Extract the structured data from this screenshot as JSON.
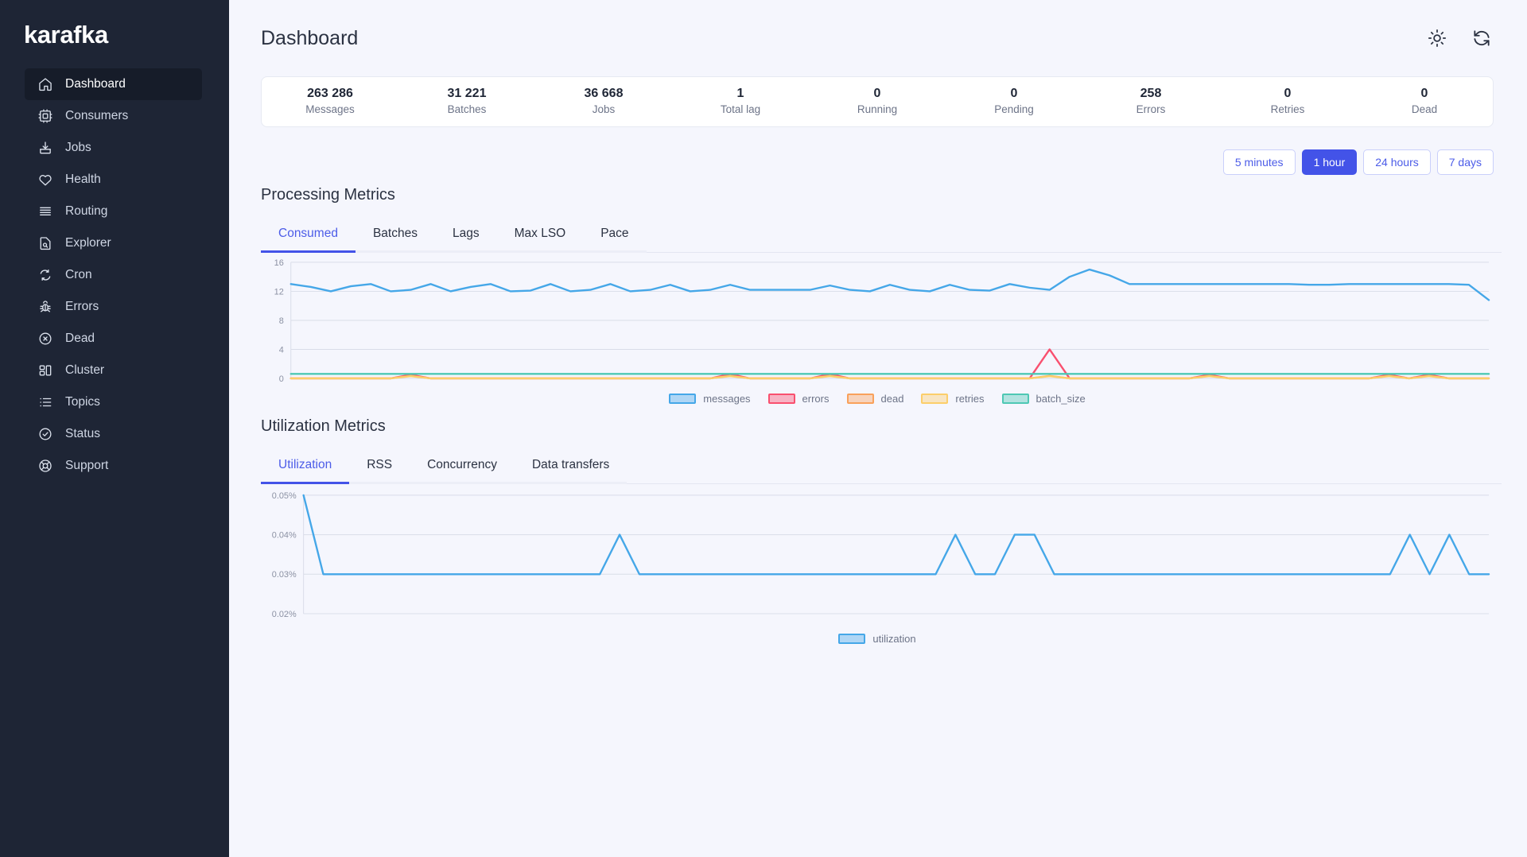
{
  "brand": "karafka",
  "sidebar": {
    "items": [
      {
        "label": "Dashboard",
        "icon": "home-icon",
        "active": true
      },
      {
        "label": "Consumers",
        "icon": "chip-icon",
        "active": false
      },
      {
        "label": "Jobs",
        "icon": "download-box-icon",
        "active": false
      },
      {
        "label": "Health",
        "icon": "heart-icon",
        "active": false
      },
      {
        "label": "Routing",
        "icon": "layers-icon",
        "active": false
      },
      {
        "label": "Explorer",
        "icon": "file-search-icon",
        "active": false
      },
      {
        "label": "Cron",
        "icon": "refresh-cycle-icon",
        "active": false
      },
      {
        "label": "Errors",
        "icon": "bug-icon",
        "active": false
      },
      {
        "label": "Dead",
        "icon": "circle-x-icon",
        "active": false
      },
      {
        "label": "Cluster",
        "icon": "grid-blocks-icon",
        "active": false
      },
      {
        "label": "Topics",
        "icon": "list-icon",
        "active": false
      },
      {
        "label": "Status",
        "icon": "circle-check-icon",
        "active": false
      },
      {
        "label": "Support",
        "icon": "lifebuoy-icon",
        "active": false
      }
    ]
  },
  "header": {
    "title": "Dashboard",
    "theme_toggle_icon": "sun-icon",
    "refresh_icon": "refresh-icon"
  },
  "stats": [
    {
      "value": "263 286",
      "label": "Messages"
    },
    {
      "value": "31 221",
      "label": "Batches"
    },
    {
      "value": "36 668",
      "label": "Jobs"
    },
    {
      "value": "1",
      "label": "Total lag"
    },
    {
      "value": "0",
      "label": "Running"
    },
    {
      "value": "0",
      "label": "Pending"
    },
    {
      "value": "258",
      "label": "Errors"
    },
    {
      "value": "0",
      "label": "Retries"
    },
    {
      "value": "0",
      "label": "Dead"
    }
  ],
  "time_ranges": [
    {
      "label": "5 minutes",
      "active": false
    },
    {
      "label": "1 hour",
      "active": true
    },
    {
      "label": "24 hours",
      "active": false
    },
    {
      "label": "7 days",
      "active": false
    }
  ],
  "processing": {
    "title": "Processing Metrics",
    "tabs": [
      {
        "label": "Consumed",
        "active": true
      },
      {
        "label": "Batches",
        "active": false
      },
      {
        "label": "Lags",
        "active": false
      },
      {
        "label": "Max LSO",
        "active": false
      },
      {
        "label": "Pace",
        "active": false
      }
    ]
  },
  "utilization": {
    "title": "Utilization Metrics",
    "tabs": [
      {
        "label": "Utilization",
        "active": true
      },
      {
        "label": "RSS",
        "active": false
      },
      {
        "label": "Concurrency",
        "active": false
      },
      {
        "label": "Data transfers",
        "active": false
      }
    ]
  },
  "colors": {
    "accent": "#4353e8",
    "messages": "#45a7e8",
    "errors": "#f9506f",
    "dead": "#f9a15b",
    "retries": "#fcce6a",
    "batch_size": "#4ec8b4",
    "sidebar_bg": "#1e2535",
    "page_bg": "#f5f6fd"
  },
  "chart_data": [
    {
      "type": "line",
      "title": "Consumed",
      "xlabel": "",
      "ylabel": "",
      "ylim": [
        0,
        16
      ],
      "yticks": [
        0,
        4,
        8,
        12,
        16
      ],
      "grid": true,
      "legend_position": "bottom",
      "x": [
        0,
        1,
        2,
        3,
        4,
        5,
        6,
        7,
        8,
        9,
        10,
        11,
        12,
        13,
        14,
        15,
        16,
        17,
        18,
        19,
        20,
        21,
        22,
        23,
        24,
        25,
        26,
        27,
        28,
        29,
        30,
        31,
        32,
        33,
        34,
        35,
        36,
        37,
        38,
        39,
        40,
        41,
        42,
        43,
        44,
        45,
        46,
        47,
        48,
        49,
        50,
        51,
        52,
        53,
        54,
        55,
        56,
        57,
        58,
        59,
        60
      ],
      "series": [
        {
          "name": "messages",
          "color": "#45a7e8",
          "values": [
            13,
            12.6,
            12,
            12.7,
            13,
            12,
            12.2,
            13,
            12,
            12.6,
            13,
            12,
            12.1,
            13,
            12,
            12.2,
            13,
            12,
            12.2,
            12.9,
            12,
            12.2,
            12.9,
            12.2,
            12.2,
            12.2,
            12.2,
            12.8,
            12.2,
            12,
            12.9,
            12.2,
            12,
            12.9,
            12.2,
            12.1,
            13,
            12.5,
            12.2,
            14,
            15,
            14.2,
            13,
            13,
            13,
            13,
            13,
            13,
            13,
            13,
            13,
            12.9,
            12.9,
            13,
            13,
            13,
            13,
            13,
            13,
            12.9,
            10.8
          ]
        },
        {
          "name": "errors",
          "color": "#f9506f",
          "values": [
            0,
            0,
            0,
            0,
            0,
            0,
            0.5,
            0,
            0,
            0,
            0,
            0,
            0,
            0,
            0,
            0,
            0,
            0,
            0,
            0,
            0,
            0,
            0.6,
            0,
            0,
            0,
            0,
            0.6,
            0,
            0,
            0,
            0,
            0,
            0,
            0,
            0,
            0,
            0,
            4,
            0,
            0,
            0,
            0,
            0,
            0,
            0,
            0.5,
            0,
            0,
            0,
            0,
            0,
            0,
            0,
            0,
            0.5,
            0,
            0.5,
            0,
            0,
            0
          ]
        },
        {
          "name": "dead",
          "color": "#f9a15b",
          "values": [
            0,
            0,
            0,
            0,
            0,
            0,
            0.35,
            0,
            0,
            0,
            0,
            0,
            0,
            0,
            0,
            0,
            0,
            0,
            0,
            0,
            0,
            0,
            0.35,
            0,
            0,
            0,
            0,
            0.35,
            0,
            0,
            0,
            0,
            0,
            0,
            0,
            0,
            0,
            0,
            0.35,
            0,
            0,
            0,
            0,
            0,
            0,
            0,
            0.35,
            0,
            0,
            0,
            0,
            0,
            0,
            0,
            0,
            0.35,
            0,
            0.35,
            0,
            0,
            0
          ]
        },
        {
          "name": "retries",
          "color": "#fcce6a",
          "values": [
            0,
            0,
            0,
            0,
            0,
            0,
            0.3,
            0,
            0,
            0,
            0,
            0,
            0,
            0,
            0,
            0,
            0,
            0,
            0,
            0,
            0,
            0,
            0.3,
            0,
            0,
            0,
            0,
            0.3,
            0,
            0,
            0,
            0,
            0,
            0,
            0,
            0,
            0,
            0,
            0.3,
            0,
            0,
            0,
            0,
            0,
            0,
            0,
            0.3,
            0,
            0,
            0,
            0,
            0,
            0,
            0,
            0,
            0.3,
            0,
            0.3,
            0,
            0,
            0
          ]
        },
        {
          "name": "batch_size",
          "color": "#4ec8b4",
          "values": [
            0.62,
            0.62,
            0.62,
            0.62,
            0.62,
            0.62,
            0.62,
            0.62,
            0.62,
            0.62,
            0.62,
            0.62,
            0.62,
            0.62,
            0.62,
            0.62,
            0.62,
            0.62,
            0.62,
            0.62,
            0.62,
            0.62,
            0.62,
            0.62,
            0.62,
            0.62,
            0.62,
            0.62,
            0.62,
            0.62,
            0.62,
            0.62,
            0.62,
            0.62,
            0.62,
            0.62,
            0.62,
            0.62,
            0.62,
            0.62,
            0.62,
            0.62,
            0.62,
            0.62,
            0.62,
            0.62,
            0.62,
            0.62,
            0.62,
            0.62,
            0.62,
            0.62,
            0.62,
            0.62,
            0.62,
            0.62,
            0.62,
            0.62,
            0.62,
            0.62,
            0.62
          ]
        }
      ],
      "legend": [
        {
          "name": "messages",
          "color": "#45a7e8"
        },
        {
          "name": "errors",
          "color": "#f9506f"
        },
        {
          "name": "dead",
          "color": "#f9a15b"
        },
        {
          "name": "retries",
          "color": "#fcce6a"
        },
        {
          "name": "batch_size",
          "color": "#4ec8b4"
        }
      ]
    },
    {
      "type": "line",
      "title": "Utilization",
      "xlabel": "",
      "ylabel": "",
      "ylim": [
        0.02,
        0.05
      ],
      "yticks": [
        0.02,
        0.03,
        0.04,
        0.05
      ],
      "ytick_labels": [
        "0.02%",
        "0.03%",
        "0.04%",
        "0.05%"
      ],
      "grid": true,
      "legend_position": "bottom",
      "x": [
        0,
        1,
        2,
        3,
        4,
        5,
        6,
        7,
        8,
        9,
        10,
        11,
        12,
        13,
        14,
        15,
        16,
        17,
        18,
        19,
        20,
        21,
        22,
        23,
        24,
        25,
        26,
        27,
        28,
        29,
        30,
        31,
        32,
        33,
        34,
        35,
        36,
        37,
        38,
        39,
        40,
        41,
        42,
        43,
        44,
        45,
        46,
        47,
        48,
        49,
        50,
        51,
        52,
        53,
        54,
        55,
        56,
        57,
        58,
        59,
        60
      ],
      "series": [
        {
          "name": "utilization",
          "color": "#45a7e8",
          "values": [
            0.05,
            0.03,
            0.03,
            0.03,
            0.03,
            0.03,
            0.03,
            0.03,
            0.03,
            0.03,
            0.03,
            0.03,
            0.03,
            0.03,
            0.03,
            0.03,
            0.04,
            0.03,
            0.03,
            0.03,
            0.03,
            0.03,
            0.03,
            0.03,
            0.03,
            0.03,
            0.03,
            0.03,
            0.03,
            0.03,
            0.03,
            0.03,
            0.03,
            0.04,
            0.03,
            0.03,
            0.04,
            0.04,
            0.03,
            0.03,
            0.03,
            0.03,
            0.03,
            0.03,
            0.03,
            0.03,
            0.03,
            0.03,
            0.03,
            0.03,
            0.03,
            0.03,
            0.03,
            0.03,
            0.03,
            0.03,
            0.04,
            0.03,
            0.04,
            0.03,
            0.03
          ]
        }
      ],
      "legend": [
        {
          "name": "utilization",
          "color": "#45a7e8"
        }
      ]
    }
  ]
}
